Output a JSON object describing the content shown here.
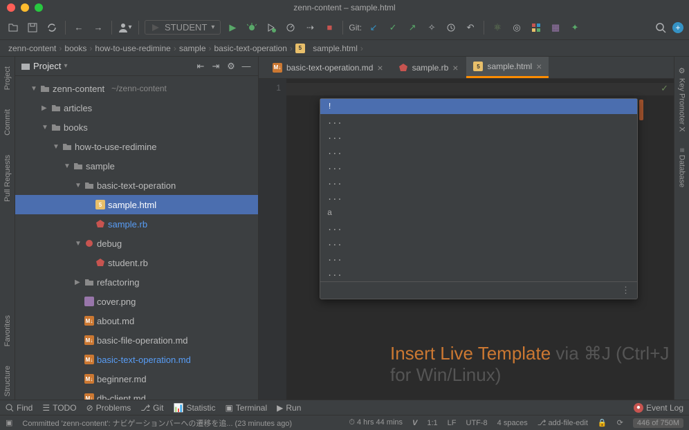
{
  "window": {
    "title": "zenn-content – sample.html"
  },
  "toolbar": {
    "runConfig": "STUDENT",
    "gitLabel": "Git:"
  },
  "breadcrumb": [
    "zenn-content",
    "books",
    "how-to-use-redimine",
    "sample",
    "basic-text-operation",
    "sample.html"
  ],
  "sidebar": {
    "title": "Project",
    "root": {
      "name": "zenn-content",
      "path": "~/zenn-content"
    },
    "tree": [
      {
        "d": 1,
        "arrow": "▼",
        "icon": "folder-root",
        "name": "zenn-content",
        "suffix": "~/zenn-content"
      },
      {
        "d": 2,
        "arrow": "▶",
        "icon": "folder",
        "name": "articles"
      },
      {
        "d": 2,
        "arrow": "▼",
        "icon": "folder",
        "name": "books"
      },
      {
        "d": 3,
        "arrow": "▼",
        "icon": "folder",
        "name": "how-to-use-redimine"
      },
      {
        "d": 4,
        "arrow": "▼",
        "icon": "folder",
        "name": "sample"
      },
      {
        "d": 5,
        "arrow": "▼",
        "icon": "folder",
        "name": "basic-text-operation"
      },
      {
        "d": 6,
        "arrow": "",
        "icon": "html",
        "name": "sample.html",
        "selected": true,
        "cls": "green-txt"
      },
      {
        "d": 6,
        "arrow": "",
        "icon": "rb",
        "name": "sample.rb",
        "cls": "highlighted"
      },
      {
        "d": 5,
        "arrow": "▼",
        "icon": "debug",
        "name": "debug"
      },
      {
        "d": 6,
        "arrow": "",
        "icon": "rb",
        "name": "student.rb"
      },
      {
        "d": 5,
        "arrow": "▶",
        "icon": "folder",
        "name": "refactoring"
      },
      {
        "d": 5,
        "arrow": "",
        "icon": "img",
        "name": "cover.png"
      },
      {
        "d": 5,
        "arrow": "",
        "icon": "md",
        "name": "about.md"
      },
      {
        "d": 5,
        "arrow": "",
        "icon": "md",
        "name": "basic-file-operation.md"
      },
      {
        "d": 5,
        "arrow": "",
        "icon": "md",
        "name": "basic-text-operation.md",
        "cls": "highlighted"
      },
      {
        "d": 5,
        "arrow": "",
        "icon": "md",
        "name": "beginner.md"
      },
      {
        "d": 5,
        "arrow": "",
        "icon": "md",
        "name": "db-client.md"
      }
    ]
  },
  "tabs": [
    {
      "icon": "md",
      "name": "basic-text-operation.md",
      "active": false
    },
    {
      "icon": "rb",
      "name": "sample.rb",
      "active": false
    },
    {
      "icon": "html",
      "name": "sample.html",
      "active": true
    }
  ],
  "editor": {
    "lineNum": "1",
    "completion": [
      "!",
      "...",
      "...",
      "...",
      "...",
      "...",
      "...",
      "a",
      "...",
      "...",
      "...",
      "..."
    ]
  },
  "leftTabs": [
    "Project",
    "Commit",
    "Pull Requests",
    "Favorites",
    "Structure"
  ],
  "rightTabs": [
    "Key Promoter X",
    "Database"
  ],
  "hint": {
    "strong": "Insert Live Template",
    "rest": " via ⌘J (Ctrl+J for Win/Linux)"
  },
  "bottomBar": {
    "find": "Find",
    "todo": "TODO",
    "problems": "Problems",
    "git": "Git",
    "statistic": "Statistic",
    "terminal": "Terminal",
    "run": "Run",
    "eventLog": "Event Log"
  },
  "statusBar": {
    "commit": "Committed 'zenn-content': ナビゲーションバーへの遷移を追... (23 minutes ago)",
    "clock": "4 hrs 44 mins",
    "pos": "1:1",
    "lf": "LF",
    "enc": "UTF-8",
    "indent": "4 spaces",
    "branch": "add-file-edit",
    "mem": "446 of 750M"
  }
}
